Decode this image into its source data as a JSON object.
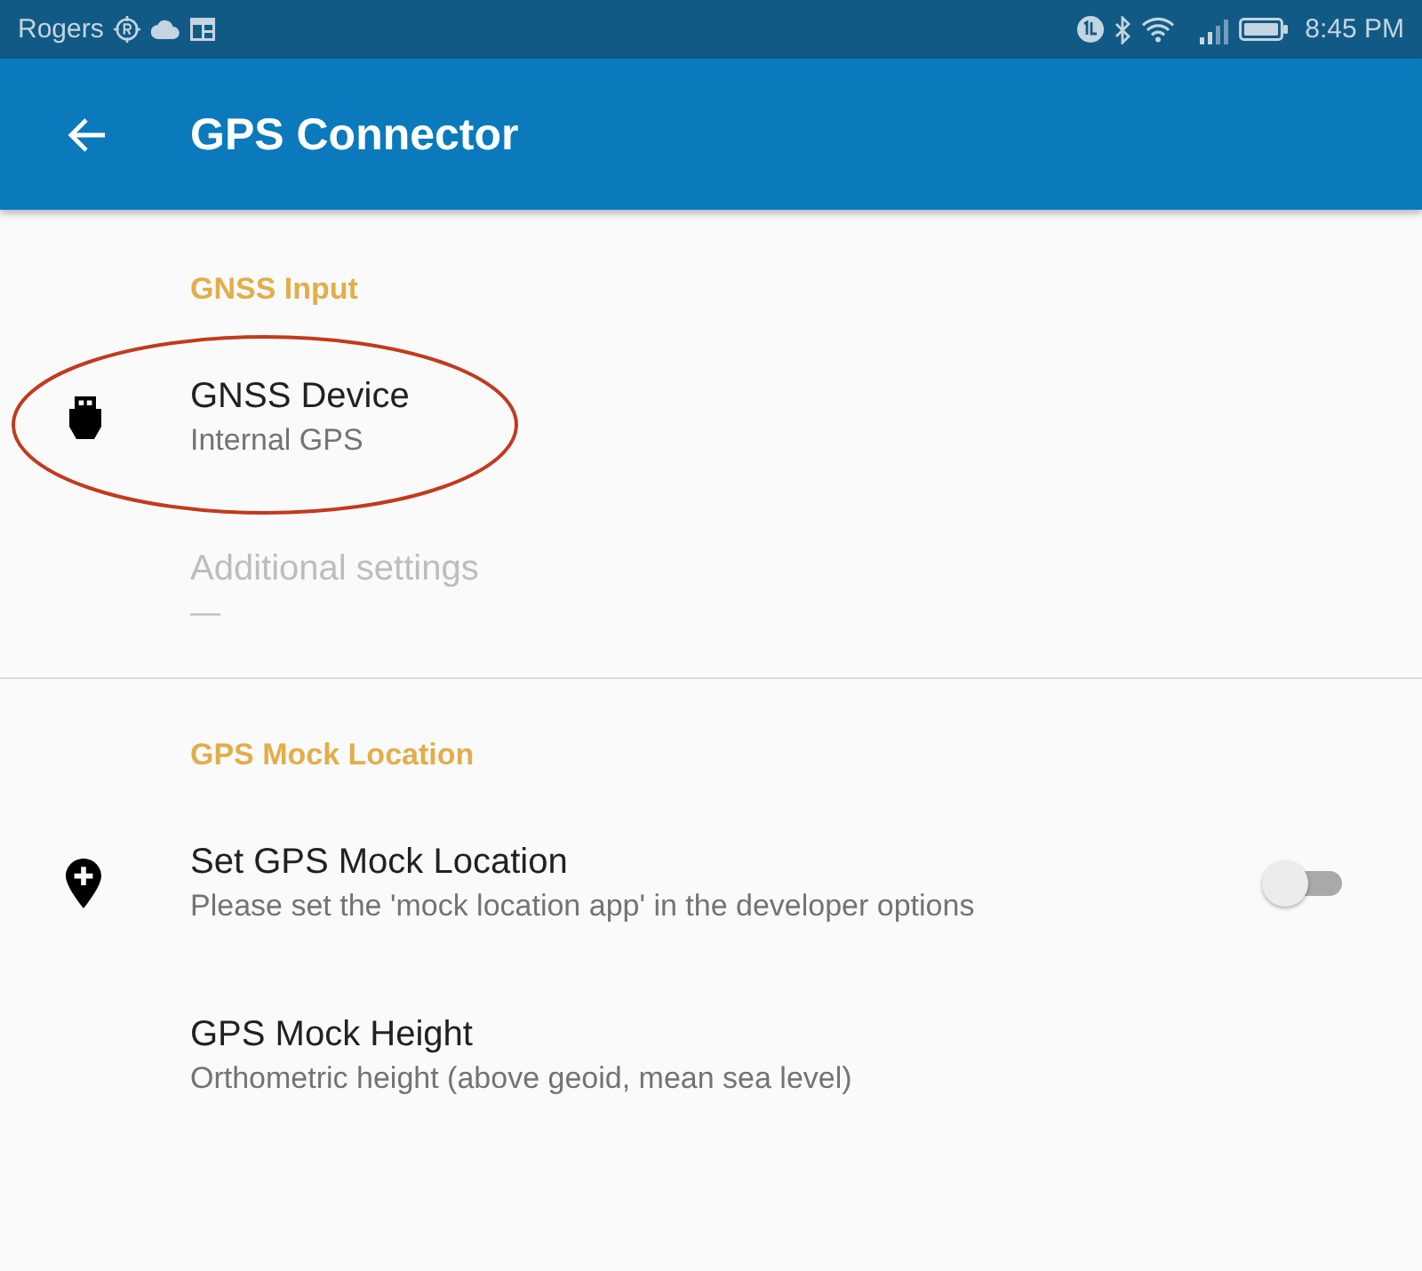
{
  "status_bar": {
    "carrier": "Rogers",
    "time": "8:45 PM"
  },
  "app_bar": {
    "title": "GPS Connector"
  },
  "sections": [
    {
      "title": "GNSS Input",
      "items": [
        {
          "kind": "connector",
          "title": "GNSS Device",
          "summary": "Internal GPS",
          "disabled": false,
          "circled": true
        },
        {
          "kind": "text",
          "title": "Additional settings",
          "summary": "—",
          "disabled": true,
          "circled": false
        }
      ]
    },
    {
      "title": "GPS Mock Location",
      "items": [
        {
          "kind": "toggle",
          "title": "Set GPS Mock Location",
          "summary": "Please set the 'mock location app' in the developer options",
          "disabled": false,
          "circled": false,
          "on": false
        },
        {
          "kind": "text",
          "title": "GPS Mock Height",
          "summary": "Orthometric height (above geoid, mean sea level)",
          "disabled": false,
          "circled": false
        }
      ]
    }
  ]
}
